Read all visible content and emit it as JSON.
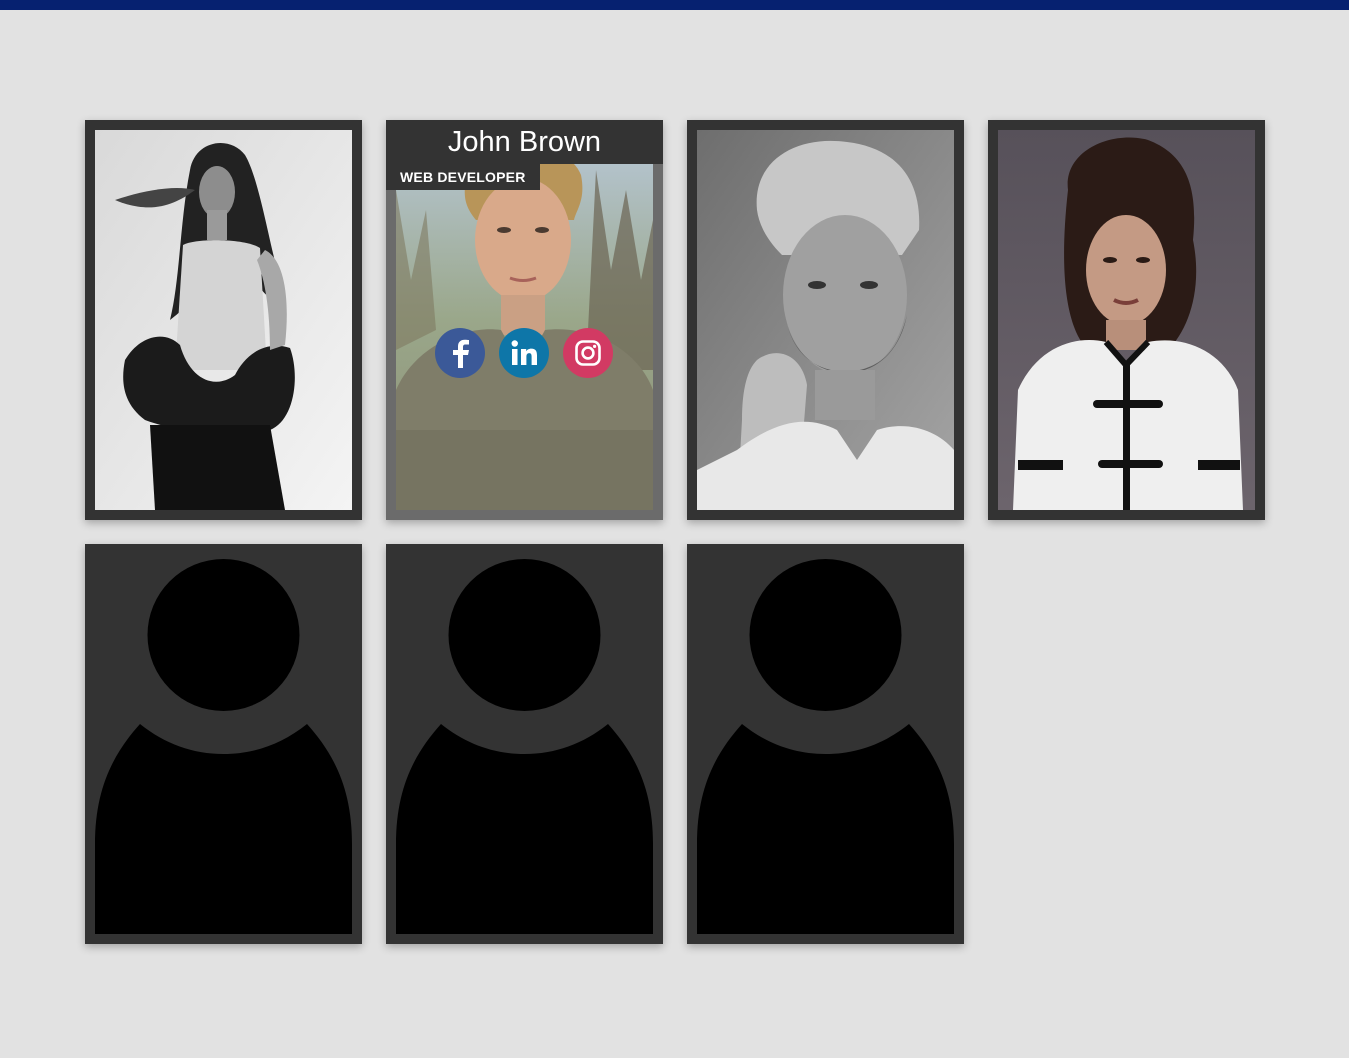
{
  "colors": {
    "page_background": "#e2e2e2",
    "top_bar": "#062170",
    "card_frame": "#333333",
    "facebook": "#3b5998",
    "linkedin": "#0e76a8",
    "instagram": "#d23a63"
  },
  "team": [
    {
      "photo": "woman-leather-jacket-bw",
      "name": "",
      "role": "",
      "type": "photo"
    },
    {
      "photo": "young-man-tshirt-color",
      "name": "John Brown",
      "role": "WEB DEVELOPER",
      "type": "photo",
      "hover": true,
      "social": [
        "facebook-icon",
        "linkedin-icon",
        "instagram-icon"
      ]
    },
    {
      "photo": "bearded-man-bw",
      "name": "",
      "role": "",
      "type": "photo"
    },
    {
      "photo": "woman-white-top",
      "name": "",
      "role": "",
      "type": "photo"
    },
    {
      "photo": "placeholder-avatar",
      "name": "",
      "role": "",
      "type": "placeholder"
    },
    {
      "photo": "placeholder-avatar",
      "name": "",
      "role": "",
      "type": "placeholder"
    },
    {
      "photo": "placeholder-avatar",
      "name": "",
      "role": "",
      "type": "placeholder"
    }
  ]
}
